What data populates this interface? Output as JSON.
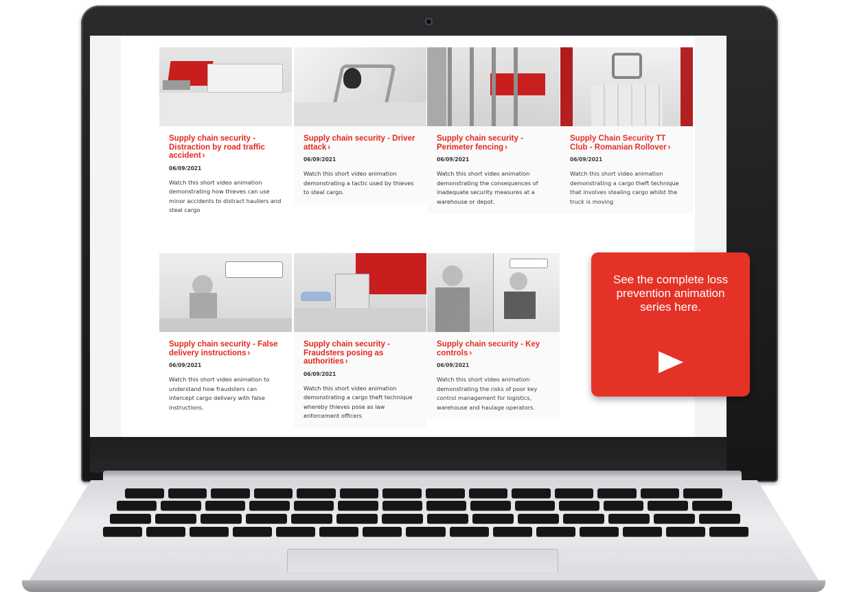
{
  "cards": [
    {
      "title": "Supply chain security - Distraction by road traffic accident",
      "chevron": "›",
      "date": "06/09/2021",
      "description": "Watch this short video animation demonstrating how thieves can use minor accidents to distract hauliers and steal cargo"
    },
    {
      "title": "Supply chain security - Driver attack",
      "chevron": "›",
      "date": "06/09/2021",
      "description": "Watch this short video animation demonstrating a tactic used by thieves to steal cargo."
    },
    {
      "title": "Supply chain security - Perimeter fencing",
      "chevron": "›",
      "date": "06/09/2021",
      "description": "Watch this short video animation demonstrating the consequences of inadequate security measures at a warehouse or depot."
    },
    {
      "title": "Supply Chain Security TT Club - Romanian Rollover",
      "chevron": "›",
      "date": "06/09/2021",
      "description": "Watch this short video animation demonstrating a cargo theft technique that involves stealing cargo whilst the truck is moving"
    },
    {
      "title": "Supply chain security - False delivery instructions",
      "chevron": "›",
      "date": "06/09/2021",
      "description": "Watch this short video animation to understand how fraudsters can intercept cargo delivery with false instructions."
    },
    {
      "title": "Supply chain security - Fraudsters posing as authorities",
      "chevron": "›",
      "date": "06/09/2021",
      "description": "Watch this short video animation demonstrating a cargo theft technique whereby thieves pose as law enforcement officers"
    },
    {
      "title": "Supply chain security - Key controls",
      "chevron": "›",
      "date": "06/09/2021",
      "description": "Watch this short video animation demonstrating the risks of poor key control management for logistics, warehouse and haulage operators."
    }
  ],
  "cta": {
    "text": "See the complete loss prevention animation series here.",
    "icon": "play-icon"
  },
  "colors": {
    "accent": "#e3261c",
    "cta_background": "#e53227",
    "laptop_bezel": "#1d1d1f"
  }
}
